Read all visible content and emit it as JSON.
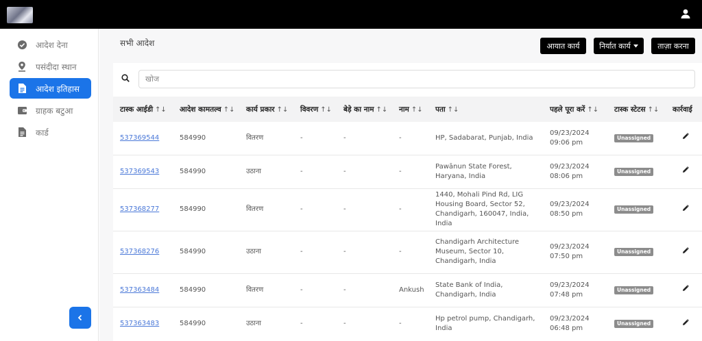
{
  "colors": {
    "accent": "#1b74e8",
    "topbar": "#000000",
    "badge": "#8c8c8c",
    "link": "#4a78d8"
  },
  "header": {
    "logo_icon": "app-logo",
    "user_icon": "user-icon"
  },
  "sidebar": {
    "items": [
      {
        "label": "आदेश देना",
        "icon": "check-circle-icon",
        "active": false
      },
      {
        "label": "पसंदीदा स्थान",
        "icon": "location-pin-icon",
        "active": false
      },
      {
        "label": "आदेश इतिहास",
        "icon": "document-icon",
        "active": true
      },
      {
        "label": "ग्राहक बटुआ",
        "icon": "wallet-icon",
        "active": false
      },
      {
        "label": "कार्ड",
        "icon": "document-icon",
        "active": false
      }
    ],
    "collapse_icon": "chevron-left-icon"
  },
  "main": {
    "title": "सभी आदेश",
    "buttons": {
      "import": "आयात कार्य",
      "export": "निर्यात कार्य",
      "refresh": "ताज़ा करना"
    },
    "search": {
      "placeholder": "खोज",
      "value": ""
    }
  },
  "table": {
    "columns": [
      "टास्क आईडी",
      "आदेश कामतल्व",
      "कार्य प्रकार",
      "विवरण",
      "बेड़े का नाम",
      "नाम",
      "पता",
      "पहले पूरा करें",
      "टास्क स्टेटस",
      "कार्रवाई"
    ],
    "sort_glyph": "↑↓",
    "rows": [
      {
        "task_id": "537369544",
        "order": "584990",
        "type": "वितरण",
        "desc": "-",
        "fleet": "-",
        "name": "-",
        "address": "HP, Sadabarat, Punjab, India",
        "date": "09/23/2024",
        "time": "09:06 pm",
        "status": "Unassigned"
      },
      {
        "task_id": "537369543",
        "order": "584990",
        "type": "उठाना",
        "desc": "-",
        "fleet": "-",
        "name": "-",
        "address": "Pawānun State Forest, Haryana, India",
        "date": "09/23/2024",
        "time": "08:06 pm",
        "status": "Unassigned"
      },
      {
        "task_id": "537368277",
        "order": "584990",
        "type": "वितरण",
        "desc": "-",
        "fleet": "-",
        "name": "-",
        "address": "1440, Mohali Pind Rd, LIG Housing Board, Sector 52, Chandigarh, 160047, India, India",
        "date": "09/23/2024",
        "time": "08:50 pm",
        "status": "Unassigned"
      },
      {
        "task_id": "537368276",
        "order": "584990",
        "type": "उठाना",
        "desc": "-",
        "fleet": "-",
        "name": "-",
        "address": "Chandigarh Architecture Museum, Sector 10, Chandigarh, India",
        "date": "09/23/2024",
        "time": "07:50 pm",
        "status": "Unassigned"
      },
      {
        "task_id": "537363484",
        "order": "584990",
        "type": "वितरण",
        "desc": "-",
        "fleet": "-",
        "name": "Ankush",
        "address": "State Bank of India, Chandigarh, India",
        "date": "09/23/2024",
        "time": "07:48 pm",
        "status": "Unassigned"
      },
      {
        "task_id": "537363483",
        "order": "584990",
        "type": "उठाना",
        "desc": "-",
        "fleet": "-",
        "name": "-",
        "address": "Hp petrol pump, Chandigarh, India",
        "date": "09/23/2024",
        "time": "06:48 pm",
        "status": "Unassigned"
      }
    ],
    "action_icon": "pencil-icon"
  }
}
